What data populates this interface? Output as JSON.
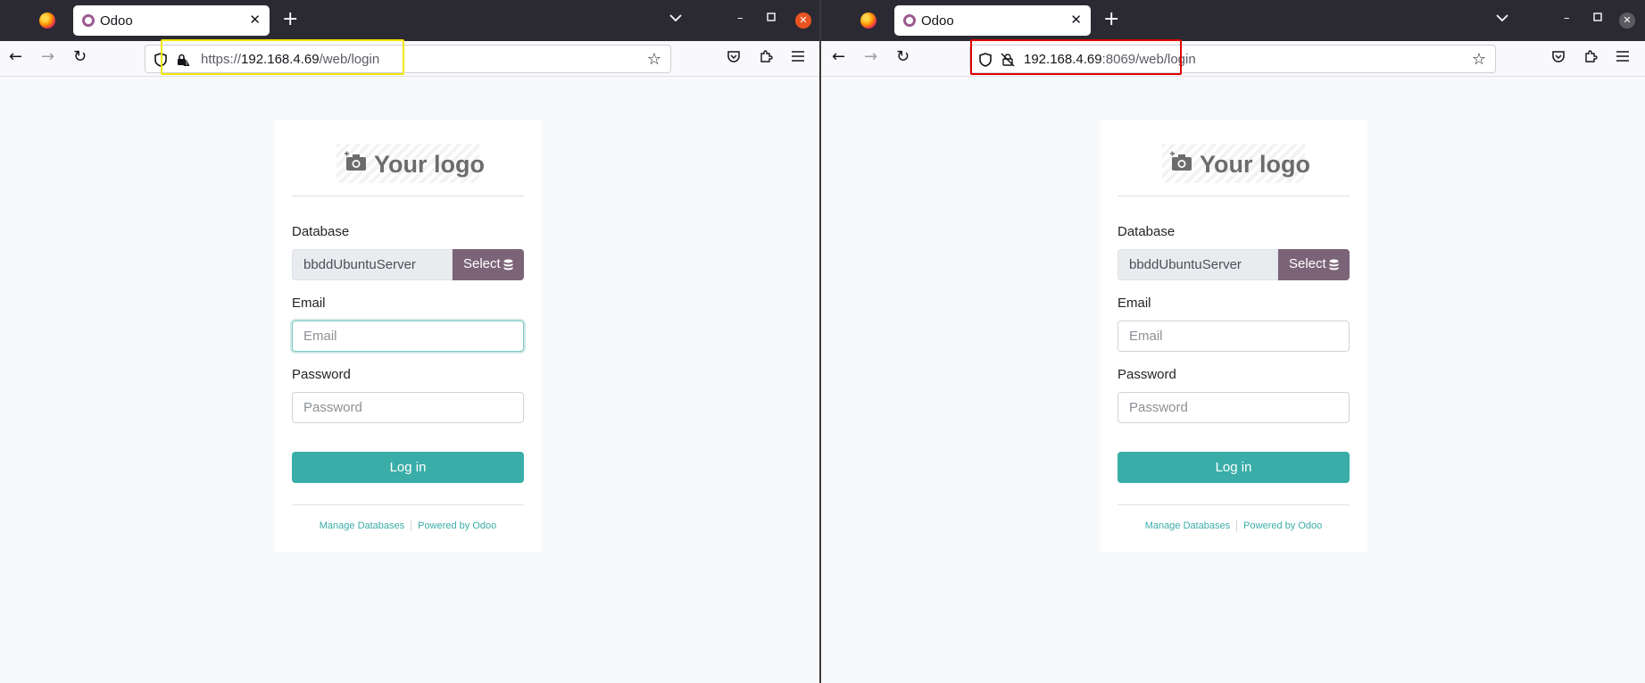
{
  "browser_left": {
    "tab_title": "Odoo",
    "url_scheme": "https://",
    "url_host": "192.168.4.69",
    "url_rest": "/web/login",
    "highlight_color": "#f2e600"
  },
  "browser_right": {
    "tab_title": "Odoo",
    "url_scheme": "",
    "url_host": "192.168.4.69",
    "url_rest": ":8069/web/login",
    "highlight_color": "#e00000"
  },
  "login": {
    "logo_text": "Your logo",
    "database_label": "Database",
    "database_value": "bbddUbuntuServer",
    "select_button": "Select",
    "email_label": "Email",
    "email_placeholder": "Email",
    "password_label": "Password",
    "password_placeholder": "Password",
    "login_button": "Log in",
    "manage_databases": "Manage Databases",
    "powered_by": "Powered by Odoo"
  },
  "colors": {
    "accent": "#3aada8",
    "select_button_bg": "#7c6478",
    "odoo_favicon": "#9b5a8f"
  },
  "icons": [
    "firefox-icon",
    "odoo-favicon",
    "close-tab-icon",
    "new-tab-icon",
    "tab-list-icon",
    "minimize-icon",
    "maximize-icon",
    "close-window-icon",
    "back-icon",
    "forward-icon",
    "reload-icon",
    "shield-icon",
    "lock-icon",
    "bookmark-star-icon",
    "pocket-icon",
    "extensions-icon",
    "menu-icon",
    "camera-icon",
    "database-icon"
  ]
}
